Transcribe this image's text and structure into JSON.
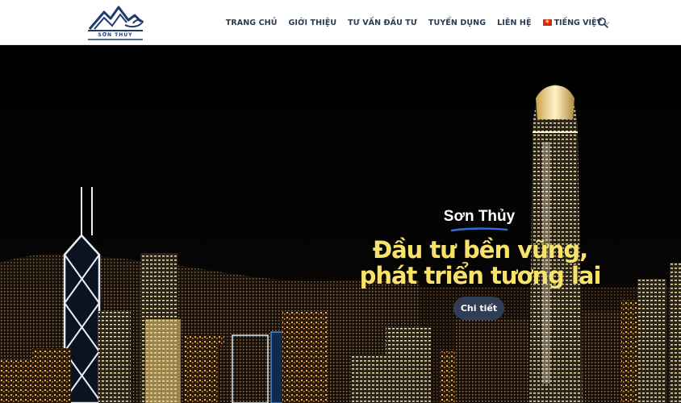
{
  "brand": {
    "logo_text": "SƠN THỦY",
    "colors": {
      "logo_navy": "#1f3b6b",
      "header_bg": "#ffffff",
      "nav_text": "#2c3a4f"
    }
  },
  "nav": {
    "items": [
      {
        "label": "TRANG CHỦ"
      },
      {
        "label": "GIỚI THIỆU"
      },
      {
        "label": "TƯ VẤN ĐẦU TƯ"
      },
      {
        "label": "TUYỂN DỤNG"
      },
      {
        "label": "LIÊN HỆ"
      }
    ],
    "language": {
      "label": "TIẾNG VIỆT",
      "flag": "vietnam-flag-icon"
    },
    "search_icon": "search-icon"
  },
  "hero": {
    "brand_name": "Sơn Thủy",
    "headline_line1": "Đầu tư bền vững,",
    "headline_line2": "phát triển tương lai",
    "cta_label": "Chi tiết",
    "colors": {
      "headline": "#f7e36c",
      "cta_bg": "#2f3e55",
      "underline": "#2f6fd6"
    }
  }
}
